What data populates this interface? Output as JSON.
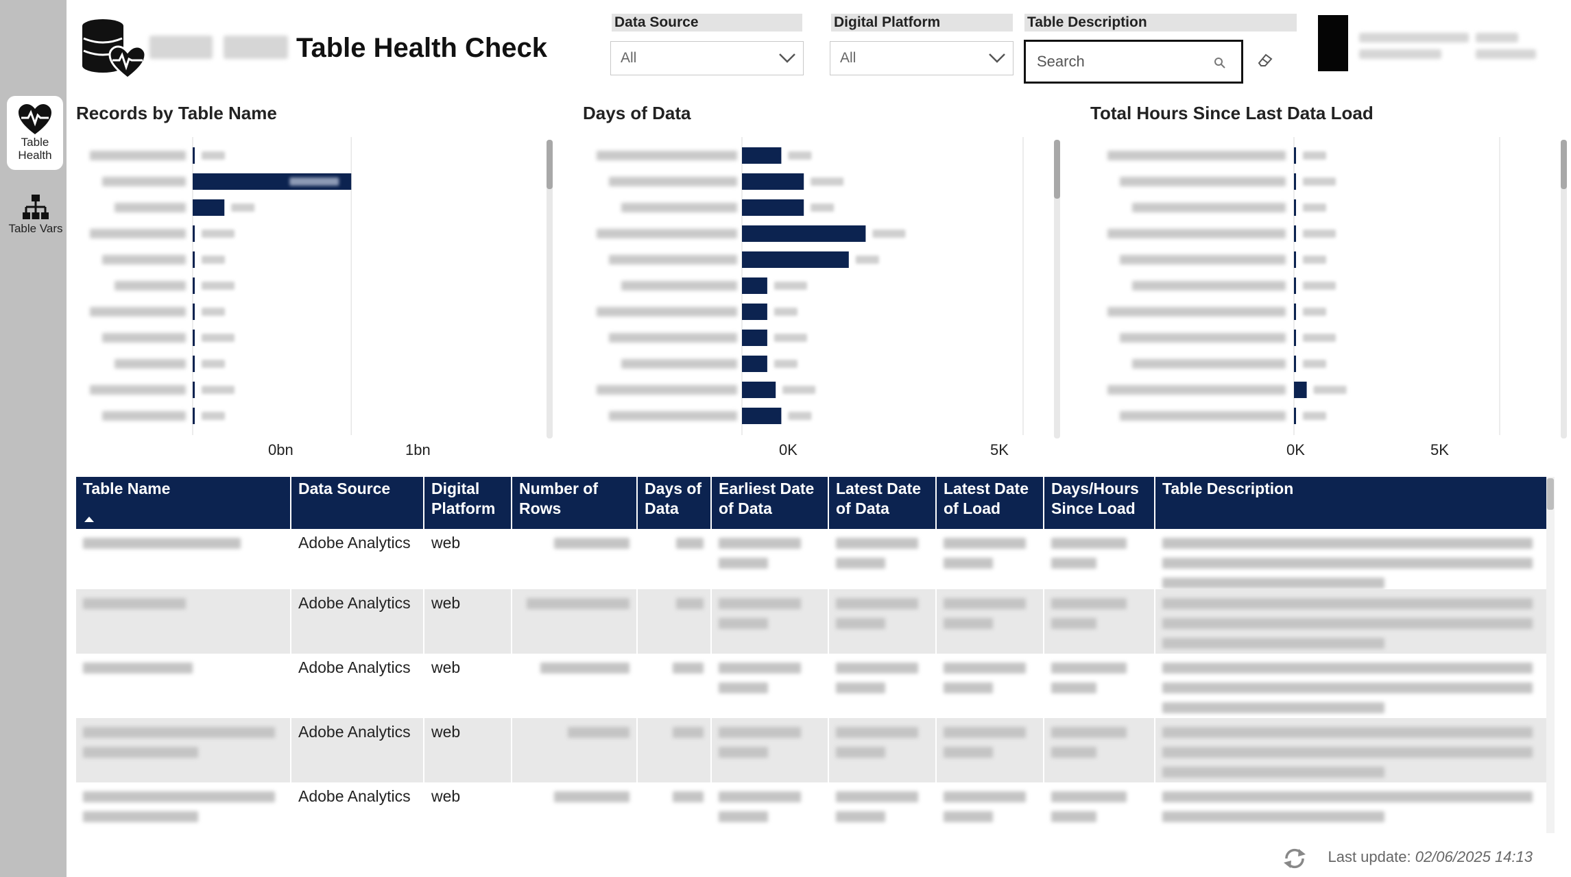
{
  "nav": {
    "items": [
      {
        "label": "Table Health",
        "icon": "heart-pulse-icon",
        "active": true
      },
      {
        "label": "Table Vars",
        "icon": "hierarchy-icon",
        "active": false
      }
    ]
  },
  "header": {
    "title": "Table Health Check",
    "icon": "database-heart-icon"
  },
  "filters": {
    "data_source": {
      "label": "Data Source",
      "value": "All"
    },
    "digital_platform": {
      "label": "Digital Platform",
      "value": "All"
    },
    "table_description": {
      "label": "Table Description",
      "placeholder": "Search"
    }
  },
  "charts": {
    "records": {
      "title": "Records by Table Name",
      "ticks": [
        "0bn",
        "1bn"
      ]
    },
    "days": {
      "title": "Days of Data",
      "ticks": [
        "0K",
        "5K"
      ]
    },
    "hours": {
      "title": "Total Hours Since Last Data Load",
      "ticks": [
        "0K",
        "5K"
      ]
    }
  },
  "chart_data": [
    {
      "type": "bar",
      "orientation": "horizontal",
      "title": "Records by Table Name",
      "xlim": [
        0,
        1.6
      ],
      "x_unit": "bn",
      "values": [
        0.01,
        1.0,
        0.2,
        0.005,
        0.005,
        0.002,
        0.002,
        0.002,
        0.002,
        0.001,
        0.001
      ],
      "color": "#0c2350"
    },
    {
      "type": "bar",
      "orientation": "horizontal",
      "title": "Days of Data",
      "xlim": [
        0,
        5000
      ],
      "x_unit": "K",
      "values": [
        700,
        1100,
        1100,
        2200,
        1900,
        450,
        450,
        450,
        450,
        600,
        700
      ],
      "color": "#0c2350"
    },
    {
      "type": "bar",
      "orientation": "horizontal",
      "title": "Total Hours Since Last Data Load",
      "xlim": [
        0,
        5000
      ],
      "x_unit": "K",
      "values": [
        40,
        20,
        20,
        20,
        20,
        20,
        20,
        20,
        20,
        310,
        20
      ],
      "color": "#0c2350"
    }
  ],
  "table": {
    "columns": [
      "Table Name",
      "Data Source",
      "Digital Platform",
      "Number of Rows",
      "Days of Data",
      "Earliest Date of Data",
      "Latest Date of Data",
      "Latest Date of Load",
      "Days/Hours Since Load",
      "Table Description"
    ],
    "rows": [
      {
        "data_source": "Adobe Analytics",
        "digital_platform": "web"
      },
      {
        "data_source": "Adobe Analytics",
        "digital_platform": "web"
      },
      {
        "data_source": "Adobe Analytics",
        "digital_platform": "web"
      },
      {
        "data_source": "Adobe Analytics",
        "digital_platform": "web"
      },
      {
        "data_source": "Adobe Analytics",
        "digital_platform": "web"
      }
    ]
  },
  "footer": {
    "label": "Last update:",
    "value": "02/06/2025 14:13"
  }
}
